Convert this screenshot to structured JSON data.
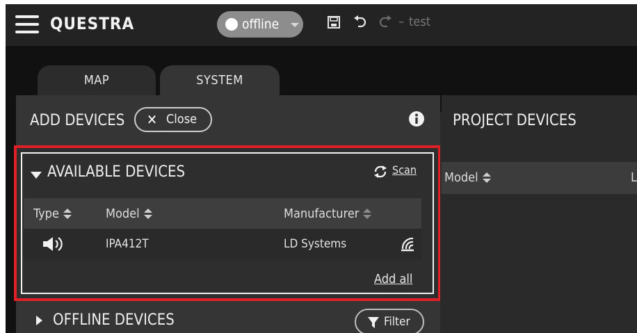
{
  "app": {
    "title": "QUESTRA",
    "project_name": "test",
    "separator": "–"
  },
  "status": {
    "label": "offline"
  },
  "tabs": [
    {
      "label": "MAP"
    },
    {
      "label": "SYSTEM"
    }
  ],
  "add_devices": {
    "title": "ADD DEVICES",
    "close_label": "Close"
  },
  "available_devices": {
    "title": "AVAILABLE DEVICES",
    "scan_label": "Scan",
    "columns": [
      "Type",
      "Model",
      "Manufacturer"
    ],
    "rows": [
      {
        "type_icon": "speaker-icon",
        "model": "IPA412T",
        "manufacturer": "LD Systems"
      }
    ],
    "add_all_label": "Add all"
  },
  "offline_devices": {
    "title": "OFFLINE DEVICES",
    "filter_label": "Filter"
  },
  "project_devices": {
    "title": "PROJECT DEVICES",
    "columns": [
      "Model",
      "L"
    ]
  },
  "colors": {
    "highlight_border": "#e11f26",
    "status_pill": "#8d8d8d",
    "background": "#111111"
  }
}
